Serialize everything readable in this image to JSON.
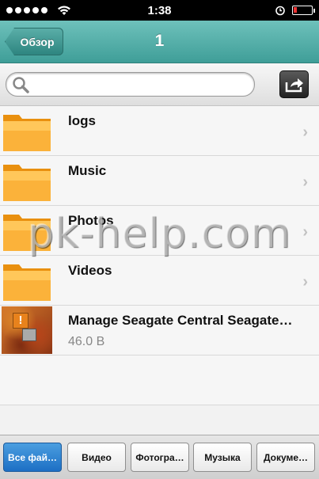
{
  "status_bar": {
    "time": "1:38"
  },
  "nav": {
    "back_label": "Обзор",
    "title": "1"
  },
  "search": {
    "placeholder": ""
  },
  "files": [
    {
      "name": "logs",
      "type": "folder"
    },
    {
      "name": "Music",
      "type": "folder"
    },
    {
      "name": "Photos",
      "type": "folder"
    },
    {
      "name": "Videos",
      "type": "folder"
    },
    {
      "name": "Manage Seagate Central Seagate…",
      "type": "file",
      "size": "46.0 B"
    }
  ],
  "watermark": "pk-help.com",
  "tabs": [
    {
      "label": "Все фай…",
      "active": true
    },
    {
      "label": "Видео",
      "active": false
    },
    {
      "label": "Фотогра…",
      "active": false
    },
    {
      "label": "Музыка",
      "active": false
    },
    {
      "label": "Докуме…",
      "active": false
    }
  ],
  "colors": {
    "nav_bar": "#3f9e98",
    "active_tab": "#1d6fc4",
    "folder": "#f7a020"
  }
}
